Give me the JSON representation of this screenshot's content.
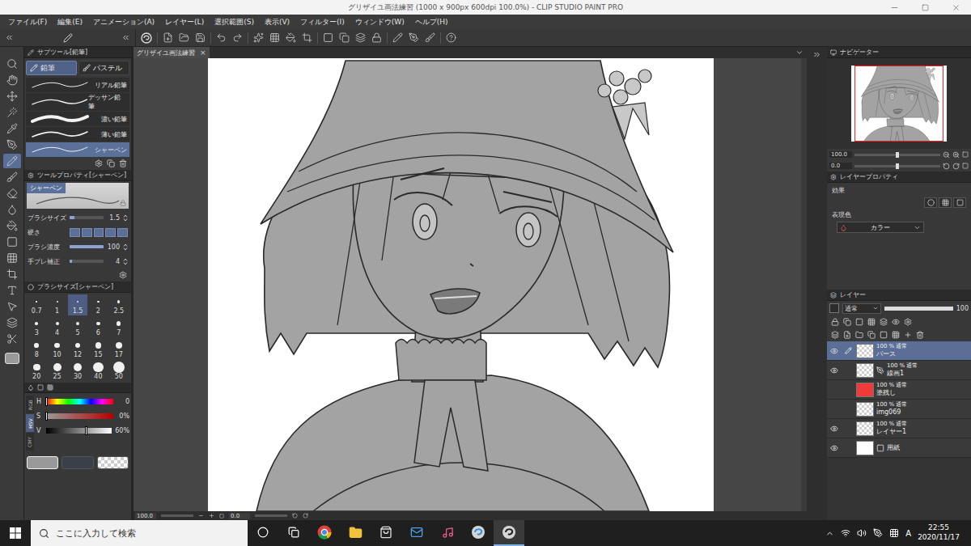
{
  "window": {
    "title": "グリザイユ画法練習 (1000 x 900px 600dpi 100.0%) - CLIP STUDIO PAINT PRO"
  },
  "menu": [
    "ファイル(F)",
    "編集(E)",
    "アニメーション(A)",
    "レイヤー(L)",
    "選択範囲(S)",
    "表示(V)",
    "フィルター(I)",
    "ウィンドウ(W)",
    "ヘルプ(H)"
  ],
  "tools": [
    {
      "selected": false
    },
    {
      "selected": false
    },
    {
      "selected": false
    },
    {
      "selected": false
    },
    {
      "selected": false
    },
    {
      "selected": false
    },
    {
      "selected": true
    },
    {
      "selected": false
    },
    {
      "selected": false
    },
    {
      "selected": false
    },
    {
      "selected": false
    },
    {
      "selected": false
    },
    {
      "selected": false
    },
    {
      "selected": false
    },
    {
      "selected": false
    },
    {
      "selected": false
    },
    {
      "selected": false
    },
    {
      "selected": false
    }
  ],
  "canvas_tab": {
    "label": "グリザイユ画法練習",
    "close": "×"
  },
  "sub_tool": {
    "title": "サブツール[鉛筆]",
    "groups": [
      {
        "label": "鉛筆",
        "selected": true
      },
      {
        "label": "パステル",
        "selected": false
      }
    ],
    "items": [
      {
        "label": "リアル鉛筆",
        "selected": false
      },
      {
        "label": "デッサン鉛筆",
        "selected": false
      },
      {
        "label": "濃い鉛筆",
        "selected": false
      },
      {
        "label": "薄い鉛筆",
        "selected": false
      },
      {
        "label": "シャーペン",
        "selected": true
      }
    ]
  },
  "tool_property": {
    "title": "ツールプロパティ[シャーペン]",
    "preview_label": "シャーペン",
    "rows": [
      {
        "label": "ブラシサイズ",
        "kind": "slider",
        "value": "1.5",
        "level": 0.15
      },
      {
        "label": "硬さ",
        "kind": "segments",
        "level": 1
      },
      {
        "label": "ブラシ濃度",
        "kind": "slider",
        "value": "100",
        "level": 1
      },
      {
        "label": "手ブレ補正",
        "kind": "slider",
        "value": "4",
        "level": 0.08
      }
    ]
  },
  "brush_size": {
    "title": "ブラシサイズ[シャーペン]",
    "sizes": [
      {
        "value": "0.7",
        "selected": false
      },
      {
        "value": "1",
        "selected": false
      },
      {
        "value": "1.5",
        "selected": true
      },
      {
        "value": "2",
        "selected": false
      },
      {
        "value": "2.5",
        "selected": false
      },
      {
        "value": "3",
        "selected": false
      },
      {
        "value": "4",
        "selected": false
      },
      {
        "value": "5",
        "selected": false
      },
      {
        "value": "6",
        "selected": false
      },
      {
        "value": "7",
        "selected": false
      },
      {
        "value": "8",
        "selected": false
      },
      {
        "value": "10",
        "selected": false
      },
      {
        "value": "12",
        "selected": false
      },
      {
        "value": "15",
        "selected": false
      },
      {
        "value": "17",
        "selected": false
      },
      {
        "value": "20",
        "selected": false
      },
      {
        "value": "25",
        "selected": false
      },
      {
        "value": "30",
        "selected": false
      },
      {
        "value": "40",
        "selected": false
      },
      {
        "value": "50",
        "selected": false
      }
    ]
  },
  "color": {
    "modes": [
      {
        "label": "RGB",
        "selected": false
      },
      {
        "label": "HSV",
        "selected": true
      },
      {
        "label": "CMY",
        "selected": false
      }
    ],
    "sliders": [
      {
        "label": "H",
        "value": "0",
        "level": 0
      },
      {
        "label": "S",
        "value": "0%",
        "level": 0
      },
      {
        "label": "V",
        "value": "60%",
        "level": 0.6
      }
    ],
    "swatches": [
      {
        "kind": "main",
        "color": "#999999",
        "selected": true
      },
      {
        "kind": "sub",
        "color": "#3a4048",
        "selected": false
      },
      {
        "kind": "transparent",
        "color": "#ffffff",
        "selected": false
      }
    ]
  },
  "status": {
    "zoom": "100.0",
    "angle": "0.0"
  },
  "navigator": {
    "title": "ナビゲーター",
    "zoom": "100.0",
    "zoom_level": 0.5,
    "angle": "0.0",
    "angle_level": 0.5
  },
  "layer_property": {
    "title": "レイヤープロパティ",
    "effect_label": "効果",
    "color_label": "表現色",
    "color_mode": "カラー"
  },
  "layers_panel": {
    "title": "レイヤー",
    "blend": "通常",
    "opacity": "100",
    "opacity_level": 1,
    "layers": [
      {
        "name": "パース",
        "mode": "100 % 通常",
        "visible": true,
        "selected": true,
        "editing": true,
        "kind": "raster",
        "color": "#b0b0b0"
      },
      {
        "name": "線画1",
        "mode": "100 % 通常",
        "visible": true,
        "selected": false,
        "editing": false,
        "kind": "vector",
        "color": "#ffffff"
      },
      {
        "name": "塗残し",
        "mode": "100 % 通常",
        "visible": false,
        "selected": false,
        "editing": false,
        "kind": "fill",
        "color": "#f03a3a"
      },
      {
        "name": "img069",
        "mode": "100 % 通常",
        "visible": false,
        "selected": false,
        "editing": false,
        "kind": "raster",
        "color": "#ffffff"
      },
      {
        "name": "レイヤー1",
        "mode": "100 % 通常",
        "visible": true,
        "selected": false,
        "editing": false,
        "kind": "raster",
        "color": "#ffffff"
      },
      {
        "name": "用紙",
        "mode": "",
        "visible": true,
        "selected": false,
        "editing": false,
        "kind": "paper",
        "color": "#ffffff"
      }
    ]
  },
  "taskbar": {
    "search_placeholder": "ここに入力して検索",
    "ime": "A",
    "time": "22:55",
    "date": "2020/11/17"
  }
}
